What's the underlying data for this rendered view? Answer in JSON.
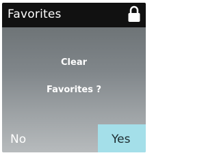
{
  "header": {
    "title": "Favorites",
    "icon": "lock-icon"
  },
  "dialog": {
    "message_line1": "Clear",
    "message_line2": "Favorites ?"
  },
  "buttons": {
    "no_label": "No",
    "yes_label": "Yes",
    "selected": "Yes"
  },
  "colors": {
    "title_bar": "#111111",
    "selection": "#a4dfe9",
    "text": "#ffffff"
  }
}
